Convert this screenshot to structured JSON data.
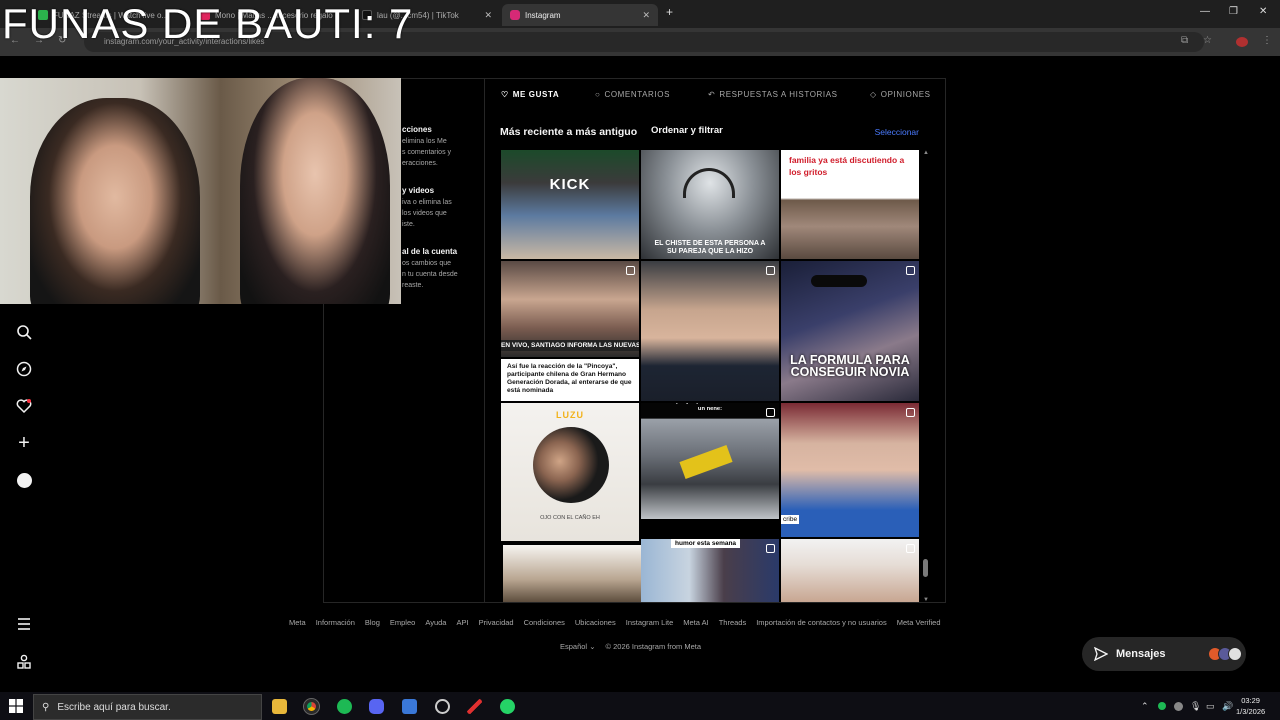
{
  "overlay": {
    "caption": "FUNAS DE BAUTI: 7"
  },
  "browser": {
    "tabs": [
      {
        "label": "FUNAZ Streams | Watch live o...",
        "color": "#2bb24c"
      },
      {
        "label": "Mono | Matias ...accesorio regalo",
        "color": "#e0245e"
      },
      {
        "label": "lau (@...cm54) | TikTok",
        "color": "#111111"
      },
      {
        "label": "Instagram",
        "color": "#d62976",
        "active": true
      }
    ],
    "url": "instagram.com/your_activity/interactions/likes",
    "new_tab": "+",
    "window_controls": [
      "—",
      "❐",
      "✕"
    ]
  },
  "settings_panel": {
    "groups": [
      {
        "title": "cciones",
        "desc": "elimina los Me\ns comentarios y\neracciones."
      },
      {
        "title": "y videos",
        "desc": "iva o elimina las\nlos videos que\niste."
      },
      {
        "title": "al de la cuenta",
        "desc": "os cambios que\nn tu cuenta desde\nreaste."
      }
    ]
  },
  "activity": {
    "tabs": [
      {
        "label": "ME GUSTA",
        "icon": "heart-icon",
        "active": true
      },
      {
        "label": "COMENTARIOS",
        "icon": "comment-icon"
      },
      {
        "label": "RESPUESTAS A HISTORIAS",
        "icon": "reply-icon"
      },
      {
        "label": "OPINIONES",
        "icon": "tag-icon"
      }
    ],
    "sort_label": "Más reciente a más antiguo",
    "filter_label": "Ordenar y filtrar",
    "select_label": "Seleccionar",
    "grid": [
      {
        "caption": "KICK"
      },
      {
        "caption": "EL CHISTE DE ESTA PERSONA A SU PAREJA QUE LA HIZO"
      },
      {
        "caption": "familia ya está discutiendo a los gritos"
      },
      {
        "caption": "EN VIVO, SANTIAGO INFORMA LAS NUEVAS NO"
      },
      {
        "caption": ""
      },
      {
        "caption": "LA FORMULA PARA CONSEGUIR NOVIA"
      },
      {
        "caption": "Así fue la reacción de la \"Pincoya\", participante chilena de Gran Hermano Generación Dorada, al enterarse de que está nominada"
      },
      {
        "caption": "Lo que yo quería ser cuando era un nene:"
      },
      {
        "caption": "cribe"
      },
      {
        "caption": "LUZU"
      },
      {
        "caption": "OJO CON EL CAÑO EH"
      },
      {
        "caption": "humor esta semana"
      }
    ]
  },
  "footer": {
    "links": [
      "Meta",
      "Información",
      "Blog",
      "Empleo",
      "Ayuda",
      "API",
      "Privacidad",
      "Condiciones",
      "Ubicaciones",
      "Instagram Lite",
      "Meta AI",
      "Threads",
      "Importación de contactos y no usuarios",
      "Meta Verified"
    ],
    "language": "Español",
    "copyright": "© 2026 Instagram from Meta"
  },
  "messages": {
    "label": "Mensajes"
  },
  "taskbar": {
    "search_placeholder": "Escribe aquí para buscar.",
    "time": "03:29",
    "date": "1/3/2026"
  }
}
